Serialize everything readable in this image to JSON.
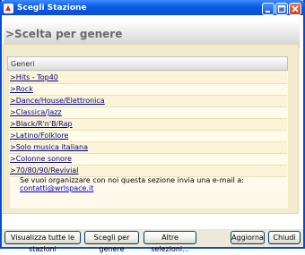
{
  "window": {
    "title": "Scegli Stazione"
  },
  "header": {
    "title": ">Scelta per genere"
  },
  "list": {
    "column_header": "Generi",
    "items": [
      ">Hits - Top40",
      ">Rock",
      ">Dance/House/Elettronica",
      ">Classica/Jazz",
      ">Black/R'n'B/Rap",
      ">Latino/Folklore",
      ">Solo musica italiana",
      ">Colonne sonore",
      ">70/80/90/Revivial"
    ]
  },
  "contact": {
    "text": "Se vuoi organizzare con noi questa sezione invia una e-mail a: ",
    "email": "contatti@wrlspace.it"
  },
  "footer": {
    "show_all": "Visualizza tutte le stazioni",
    "by_genre": "Scegli per genere",
    "other": "Altre selezioni...",
    "refresh": "Aggiorna",
    "close": "Chiudi"
  },
  "colors": {
    "titlebar": "#0a4ad0",
    "panel": "#f2ebcd",
    "link": "#000080"
  }
}
